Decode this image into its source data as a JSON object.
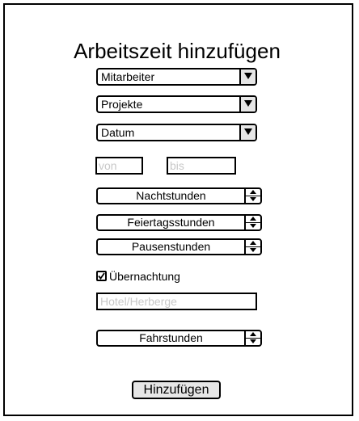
{
  "form": {
    "title": "Arbeitszeit hinzufügen",
    "employee_select": {
      "value": "Mitarbeiter",
      "icon": "chevron-down-icon"
    },
    "project_select": {
      "value": "Projekte",
      "icon": "chevron-down-icon"
    },
    "date_select": {
      "value": "Datum",
      "icon": "chevron-down-icon"
    },
    "from_field": {
      "placeholder": "von"
    },
    "to_field": {
      "placeholder": "bis"
    },
    "night_hours": {
      "label": "Nachtstunden"
    },
    "holiday_hours": {
      "label": "Feiertagsstunden"
    },
    "break_hours": {
      "label": "Pausenstunden"
    },
    "overnight_checkbox": {
      "label": "Übernachtung",
      "checked": true
    },
    "hotel_field": {
      "placeholder": "Hotel/Herberge"
    },
    "travel_hours": {
      "label": "Fahrstunden"
    },
    "submit_label": "Hinzufügen"
  },
  "colors": {
    "border": "#000000",
    "button_fill": "#e6e6e6",
    "placeholder_text": "#c8c8c8",
    "background": "#ffffff"
  }
}
